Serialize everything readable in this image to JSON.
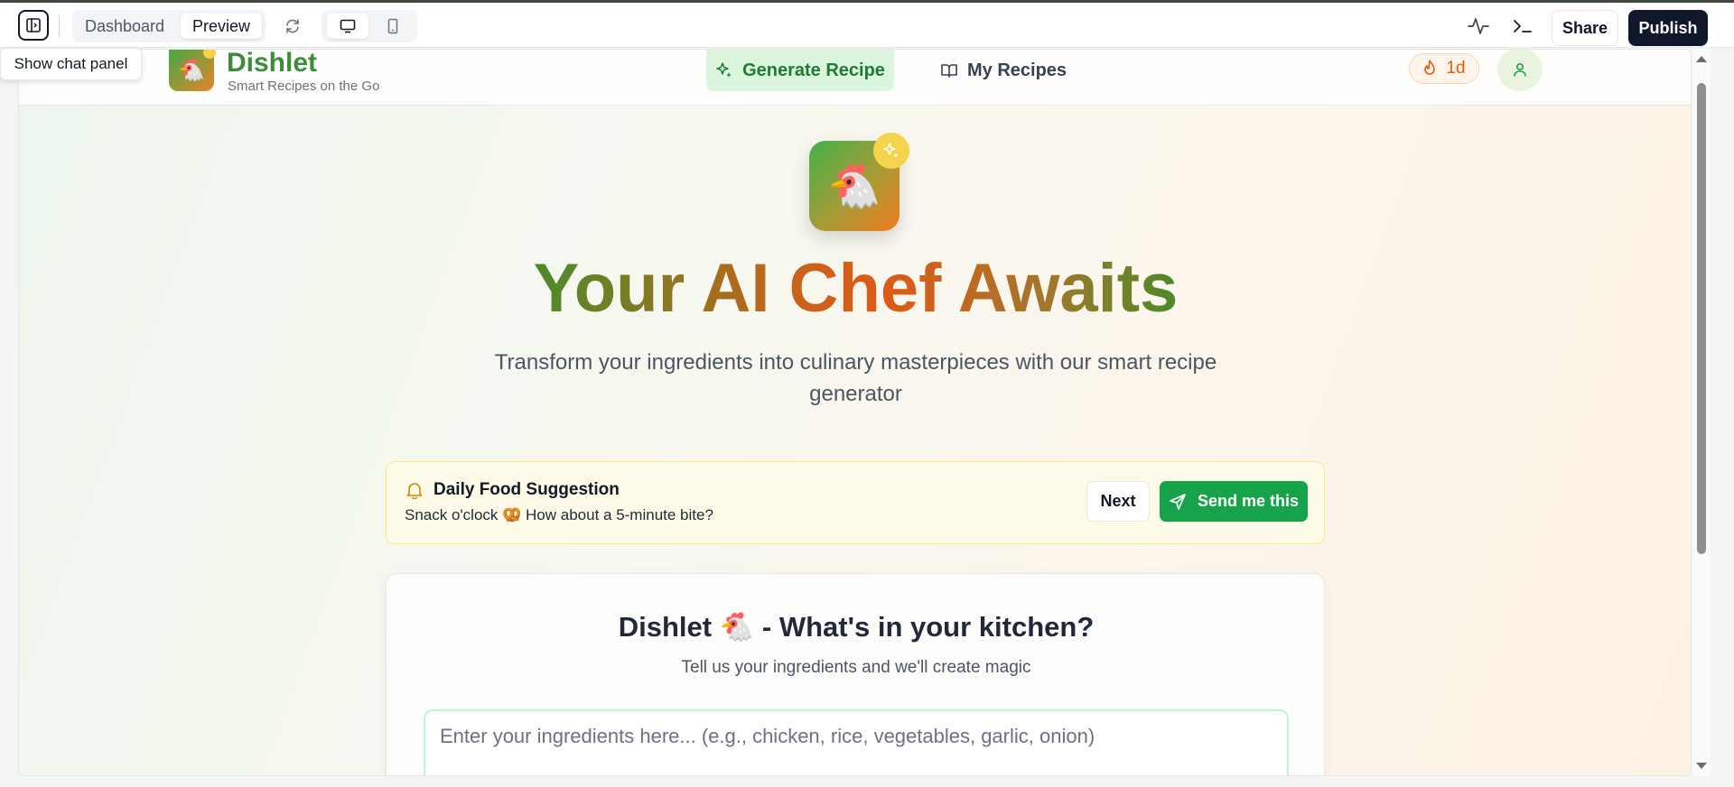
{
  "toolbar": {
    "tabs": [
      {
        "label": "Dashboard",
        "active": false
      },
      {
        "label": "Preview",
        "active": true
      }
    ],
    "share_label": "Share",
    "publish_label": "Publish",
    "tooltip": "Show chat panel",
    "icons": [
      "sidebar-toggle-icon",
      "refresh-icon",
      "desktop-icon",
      "mobile-icon",
      "activity-icon",
      "terminal-icon"
    ]
  },
  "app": {
    "brand": {
      "name": "Dishlet",
      "tagline": "Smart Recipes on the Go",
      "emoji": "🐔"
    },
    "nav": {
      "generate": "Generate Recipe",
      "my_recipes": "My Recipes"
    },
    "streak": "1d",
    "hero": {
      "emoji": "🐔",
      "title": "Your AI Chef Awaits",
      "subtitle": "Transform your ingredients into culinary masterpieces with our smart recipe generator"
    },
    "suggestion": {
      "title": "Daily Food Suggestion",
      "body": "Snack o'clock 🥨 How about a 5-minute bite?",
      "next_label": "Next",
      "send_label": "Send me this"
    },
    "kitchen": {
      "title": "Dishlet 🐔 - What's in your kitchen?",
      "subtitle": "Tell us your ingredients and we'll create magic",
      "input_placeholder": "Enter your ingredients here... (e.g., chicken, rice, vegetables, garlic, onion)"
    }
  },
  "colors": {
    "primary_green": "#16a34a",
    "publish_bg": "#0f172a",
    "streak_orange": "#ea580c",
    "suggestion_bg": "#fefce8"
  }
}
